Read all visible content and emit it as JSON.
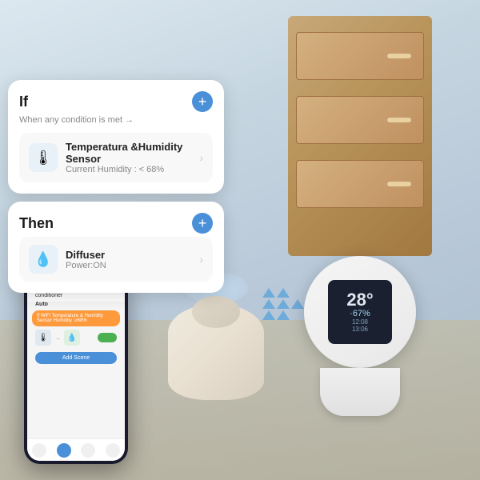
{
  "background": {
    "color_start": "#dce8f0",
    "color_end": "#a8bac8"
  },
  "thermostat": {
    "temperature": "28°",
    "humidity": "·67%",
    "time1": "12:08",
    "time2": "13:06"
  },
  "if_card": {
    "title": "If",
    "subtitle": "When any condition is met →",
    "plus_icon": "+",
    "device_name": "Temperatura &Humidity Sensor",
    "device_status": "Current Humidity : < 68%"
  },
  "then_card": {
    "title": "Then",
    "plus_icon": "+",
    "device_name": "Diffuser",
    "device_status": "Power:ON"
  },
  "phone": {
    "description": "Cold and warm effect, Temp care, Temp higher, Open air conditioner",
    "auto_label": "Auto",
    "condition_text": "If WiFi Temperature & Humidity Sensor Humidity :≥68%",
    "add_scene": "Add Scene"
  }
}
